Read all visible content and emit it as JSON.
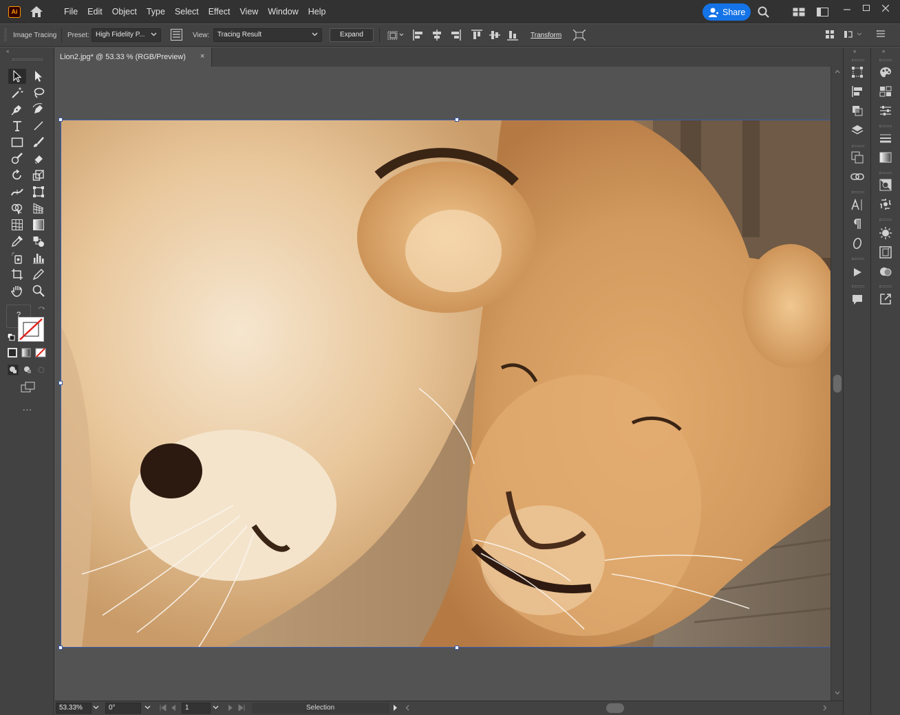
{
  "app": {
    "logo_text": "Ai",
    "menus": [
      "File",
      "Edit",
      "Object",
      "Type",
      "Select",
      "Effect",
      "View",
      "Window",
      "Help"
    ],
    "share_label": "Share"
  },
  "control_bar": {
    "image_tracing_label": "Image Tracing",
    "preset_label": "Preset:",
    "preset_value": "High Fidelity P...",
    "view_label": "View:",
    "view_value": "Tracing Result",
    "expand_label": "Expand",
    "transform_label": "Transform"
  },
  "document": {
    "tab_title": "Lion2.jpg* @ 53.33 % (RGB/Preview)",
    "close_glyph": "×"
  },
  "toolbar": {
    "unknown_badge": "?",
    "more_glyph": "..."
  },
  "status_bar": {
    "zoom": "53.33%",
    "rotation": "0°",
    "artboard": "1",
    "tool_name": "Selection"
  },
  "colors": {
    "accent": "#1473e6",
    "selection": "#3a5aa8",
    "ui_dark": "#323232",
    "ui_panel": "#424242",
    "ui_canvas": "#535353"
  }
}
